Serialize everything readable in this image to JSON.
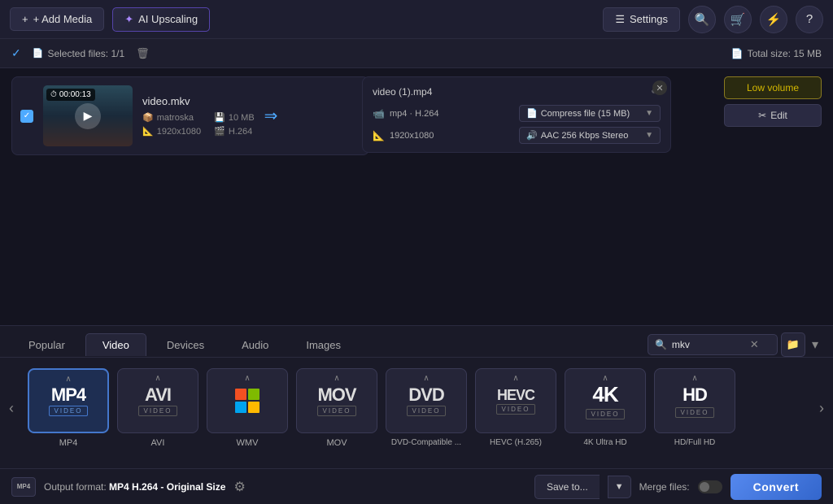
{
  "toolbar": {
    "add_media": "+ Add Media",
    "ai_upscaling": "AI Upscaling",
    "settings": "Settings",
    "icons": [
      "search",
      "cart",
      "share",
      "help"
    ]
  },
  "filebar": {
    "selected_text": "Selected files: 1/1",
    "total_size": "Total size: 15 MB"
  },
  "file_card": {
    "timestamp": "00:00:13",
    "filename": "video.mkv",
    "container": "matroska",
    "size": "10 MB",
    "resolution": "1920x1080",
    "codec": "H.264"
  },
  "output_panel": {
    "filename": "video (1).mp4",
    "format": "mp4 · H.264",
    "resolution": "1920x1080",
    "compress": "Compress file (15 MB)",
    "audio": "AAC 256 Kbps Stereo"
  },
  "action_buttons": {
    "low_volume": "Low volume",
    "edit": "Edit"
  },
  "format_tabs": {
    "tabs": [
      "Popular",
      "Video",
      "Devices",
      "Audio",
      "Images"
    ],
    "active_tab": "Video",
    "search_placeholder": "mkv",
    "search_value": "mkv"
  },
  "format_items": [
    {
      "id": "mp4",
      "logo": "MP4",
      "sub": "VIDEO",
      "label": "MP4",
      "selected": true
    },
    {
      "id": "avi",
      "logo": "AVI",
      "sub": "VIDEO",
      "label": "AVI",
      "selected": false
    },
    {
      "id": "wmv",
      "logo": "WMV",
      "sub": "",
      "label": "WMV",
      "selected": false,
      "is_windows": true
    },
    {
      "id": "mov",
      "logo": "MOV",
      "sub": "VIDEO",
      "label": "MOV",
      "selected": false
    },
    {
      "id": "dvd",
      "logo": "DVD",
      "sub": "VIDEO",
      "label": "DVD-Compatible ...",
      "selected": false
    },
    {
      "id": "hevc",
      "logo": "HEVC",
      "sub": "VIDEO",
      "label": "HEVC (H.265)",
      "selected": false
    },
    {
      "id": "4k",
      "logo": "4K",
      "sub": "VIDEO",
      "label": "4K Ultra HD",
      "selected": false
    },
    {
      "id": "hd",
      "logo": "HD",
      "sub": "VIDEO",
      "label": "HD/Full HD",
      "selected": false
    }
  ],
  "status_bar": {
    "output_label": "Output format:",
    "output_value": "MP4 H.264 - Original Size",
    "save_to": "Save to...",
    "merge_files": "Merge files:",
    "convert": "Convert"
  }
}
